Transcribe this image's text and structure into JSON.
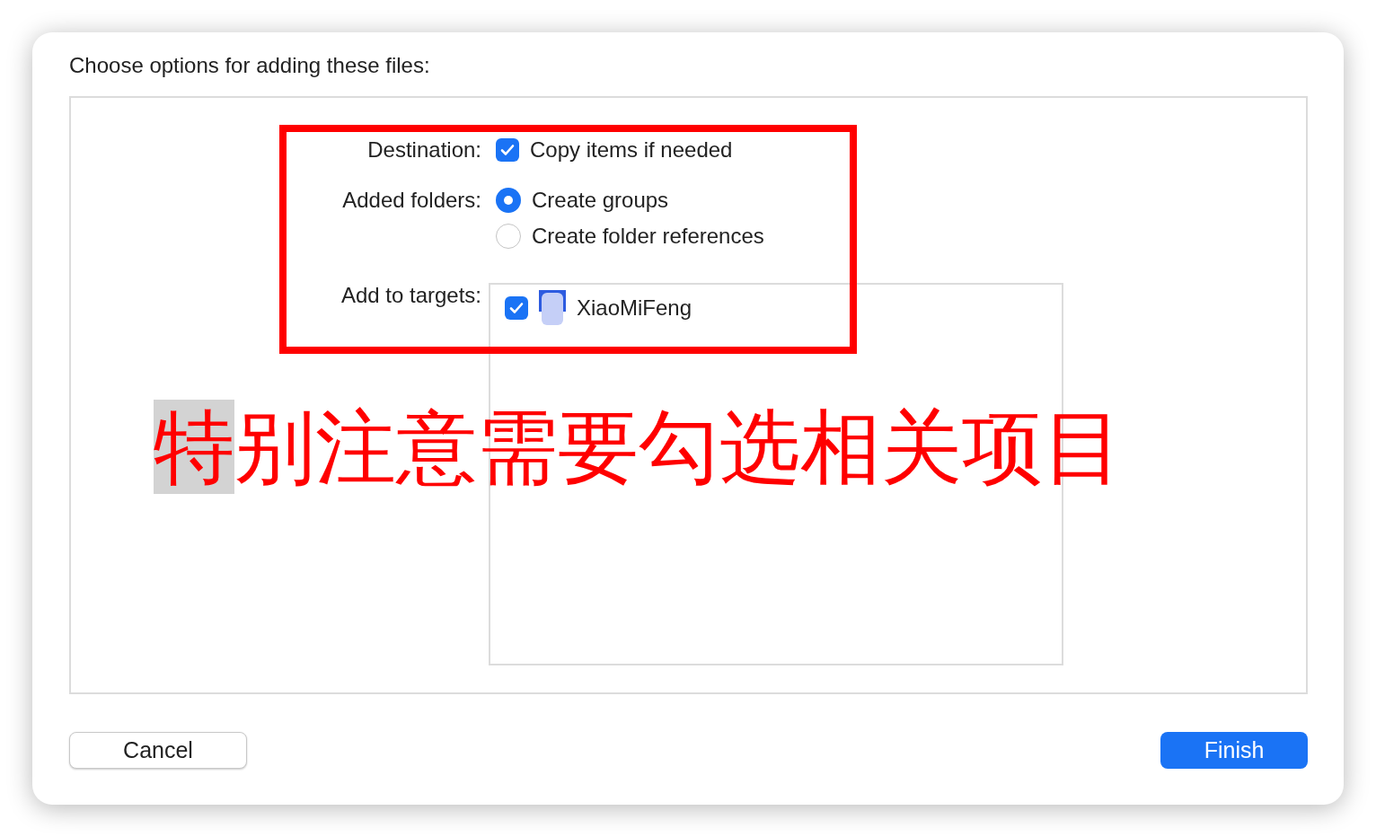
{
  "dialog": {
    "title": "Choose options for adding these files:"
  },
  "destination": {
    "label": "Destination:",
    "option": {
      "label": "Copy items if needed",
      "checked": true
    }
  },
  "added_folders": {
    "label": "Added folders:",
    "options": [
      {
        "label": "Create groups",
        "selected": true
      },
      {
        "label": "Create folder references",
        "selected": false
      }
    ]
  },
  "targets": {
    "label": "Add to targets:",
    "items": [
      {
        "name": "XiaoMiFeng",
        "checked": true
      }
    ]
  },
  "annotation": {
    "selection": "特",
    "text": "别注意需要勾选相关项目"
  },
  "buttons": [
    {
      "label": "Cancel",
      "kind": "secondary"
    },
    {
      "label": "Finish",
      "kind": "primary"
    }
  ]
}
